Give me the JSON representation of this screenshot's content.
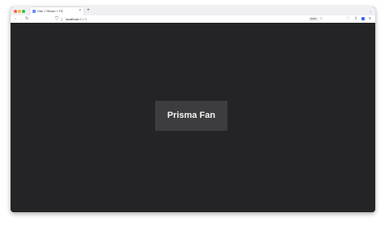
{
  "browser": {
    "tab": {
      "title": "Vite + React + TS",
      "close": "×",
      "favicon": "vite-favicon-icon"
    },
    "new_tab": "+",
    "tab_list": "⌄",
    "nav": {
      "back": "←",
      "forward": "→",
      "reload": "↻"
    },
    "url": {
      "host": "localhost",
      "port": ":5173",
      "shield_icon": "shield-icon",
      "page_icon": "page-icon"
    },
    "zoom": "300%",
    "star": "☆",
    "toolbar": {
      "pocket": "♡",
      "extensions": "⇩",
      "menu": "≡"
    }
  },
  "page": {
    "button_label": "Prisma Fan",
    "background": "#242426",
    "button_bg": "#3d3d3f",
    "button_text_color": "#f4f4f4"
  }
}
